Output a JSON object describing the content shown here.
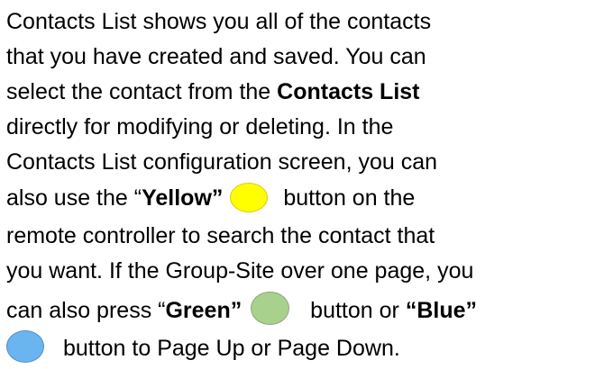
{
  "lines": [
    {
      "text": "Contacts List shows you all of the contacts"
    },
    {
      "text": "that you have created and saved. You can"
    },
    {
      "before": "select the contact from the ",
      "bold": "Contacts List"
    },
    {
      "text": "directly for modifying or deleting. In the"
    },
    {
      "text": "Contacts List configuration screen, you can"
    },
    {
      "before": "also use the “",
      "bold": "Yellow”",
      "after": " button on the"
    },
    {
      "text": "remote controller to search the contact that"
    },
    {
      "text": "you want. If the Group-Site over one page, you"
    },
    {
      "before": "can also press “",
      "bold": "Green”",
      "middle": " button or ",
      "bold2": "“Blue”"
    },
    {
      "after": " button to Page Up or Page Down."
    }
  ],
  "buttons": {
    "yellow": "#ffff00",
    "green": "#a9d18e",
    "blue": "#6ab4f0"
  }
}
